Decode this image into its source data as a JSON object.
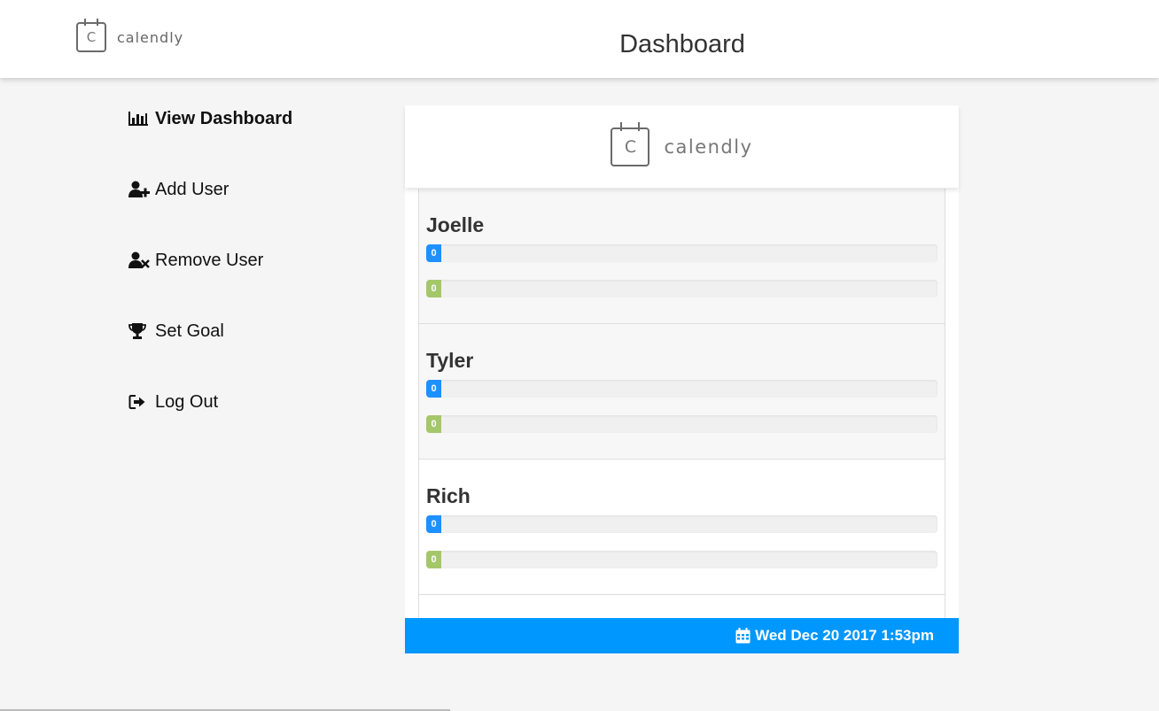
{
  "brand": {
    "name": "calendly",
    "logo_letter": "C"
  },
  "header": {
    "title": "Dashboard"
  },
  "sidebar": {
    "items": [
      {
        "label": "View Dashboard",
        "icon": "bar-chart-icon",
        "active": true
      },
      {
        "label": "Add User",
        "icon": "user-plus-icon",
        "active": false
      },
      {
        "label": "Remove User",
        "icon": "user-times-icon",
        "active": false
      },
      {
        "label": "Set Goal",
        "icon": "trophy-icon",
        "active": false
      },
      {
        "label": "Log Out",
        "icon": "sign-out-icon",
        "active": false
      }
    ]
  },
  "card": {
    "brand_name": "calendly",
    "logo_letter": "C",
    "users": [
      {
        "name": "Joelle",
        "primary_value": "0",
        "secondary_value": "0"
      },
      {
        "name": "Tyler",
        "primary_value": "0",
        "secondary_value": "0"
      },
      {
        "name": "Rich",
        "primary_value": "0",
        "secondary_value": "0"
      }
    ],
    "footer": {
      "icon": "calendar-icon",
      "datetime": "Wed Dec 20 2017 1:53pm"
    }
  },
  "colors": {
    "accent_blue": "#0097ff",
    "bar_blue": "#1e90ff",
    "bar_green": "#a5c76b",
    "page_bg": "#f5f5f5"
  }
}
